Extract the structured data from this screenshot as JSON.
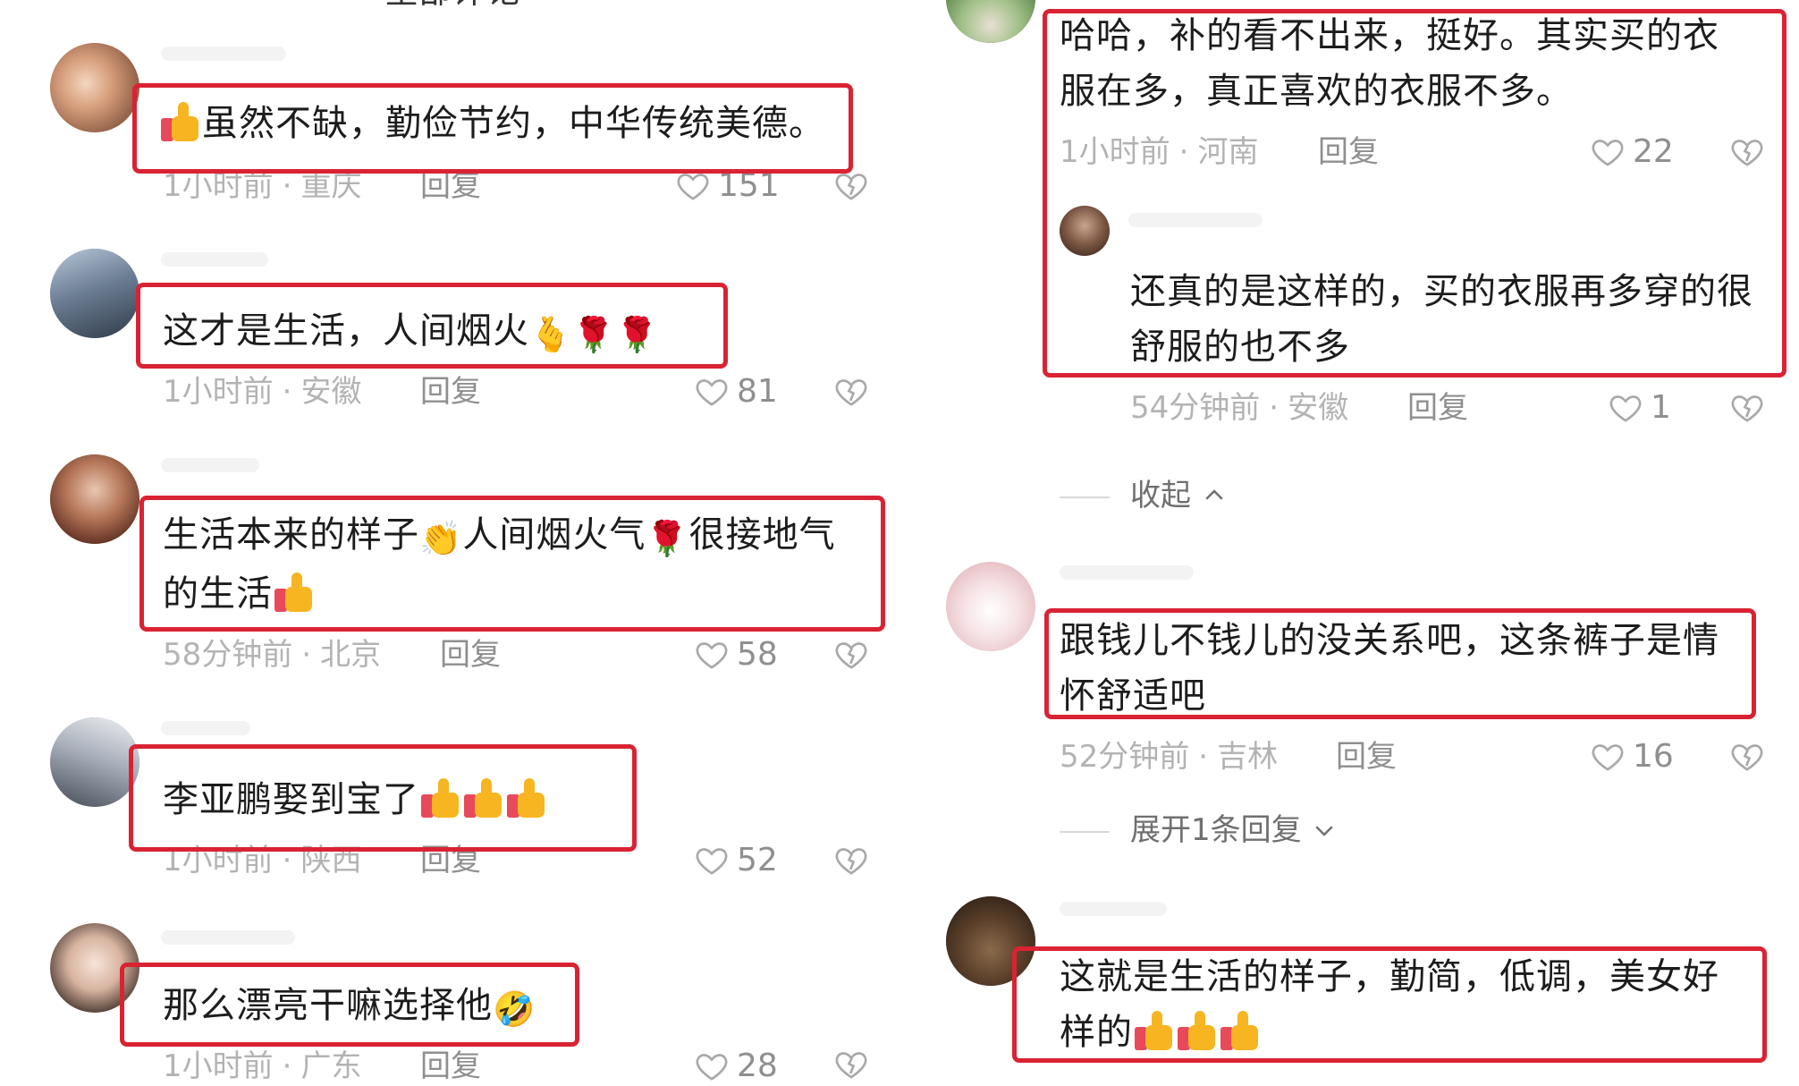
{
  "colors": {
    "highlight": "#d92333",
    "meta": "#b3b3b3",
    "reply": "#8f8f8f"
  },
  "top_partial_text": "全部评论",
  "left_comments": [
    {
      "text": "虽然不缺，勤俭节约，中华传统美德。",
      "time": "1小时前",
      "location": "重庆",
      "reply": "回复",
      "likes": "151"
    },
    {
      "text": "这才是生活，人间烟火",
      "time": "1小时前",
      "location": "安徽",
      "reply": "回复",
      "likes": "81"
    },
    {
      "line1a": "生活本来的样子",
      "line1b": "人间烟火气",
      "line1c": "很接地气",
      "line2": "的生活",
      "time": "58分钟前",
      "location": "北京",
      "reply": "回复",
      "likes": "58"
    },
    {
      "text": "李亚鹏娶到宝了",
      "time": "1小时前",
      "location": "陕西",
      "reply": "回复",
      "likes": "52"
    },
    {
      "text": "那么漂亮干嘛选择他",
      "time": "1小时前",
      "location": "广东",
      "reply": "回复",
      "likes": "28"
    }
  ],
  "right_comments": {
    "c1": {
      "line1": "哈哈，补的看不出来，挺好。其实买的衣",
      "line2": "服在多，真正喜欢的衣服不多。",
      "time": "1小时前",
      "location": "河南",
      "reply": "回复",
      "likes": "22"
    },
    "sub": {
      "line1": "还真的是这样的，买的衣服再多穿的很",
      "line2": "舒服的也不多",
      "time": "54分钟前",
      "location": "安徽",
      "reply": "回复",
      "likes": "1"
    },
    "collapse": "收起",
    "c2": {
      "line1": "跟钱儿不钱儿的没关系吧，这条裤子是情",
      "line2": "怀舒适吧",
      "time": "52分钟前",
      "location": "吉林",
      "reply": "回复",
      "likes": "16"
    },
    "expand": "展开1条回复",
    "c3": {
      "line1": "这就是生活的样子，勤简，低调，美女好",
      "line2": "样的"
    }
  }
}
